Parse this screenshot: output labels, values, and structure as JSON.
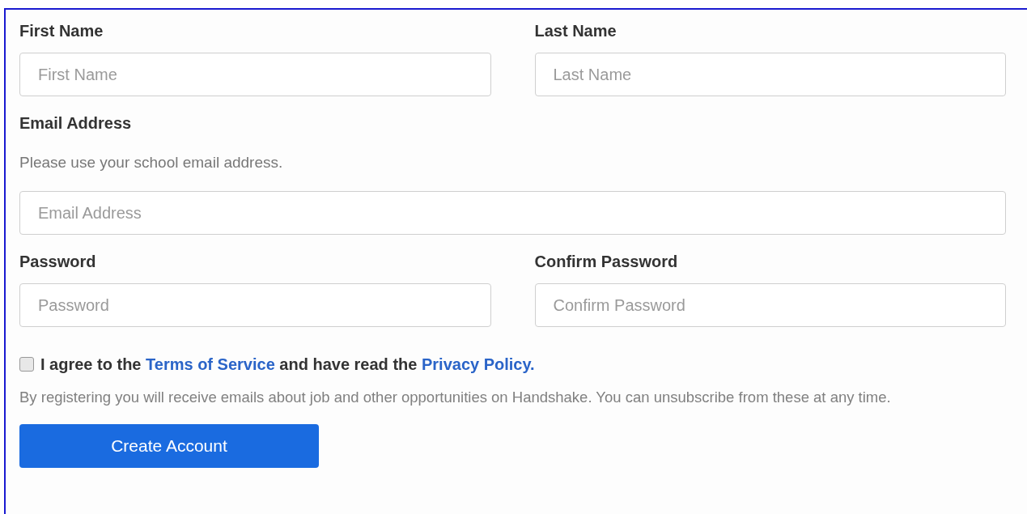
{
  "name_fields": [
    {
      "label": "First Name",
      "placeholder": "First Name"
    },
    {
      "label": "Last Name",
      "placeholder": "Last Name"
    }
  ],
  "email": {
    "label": "Email Address",
    "hint": "Please use your school email address.",
    "placeholder": "Email Address"
  },
  "password_fields": [
    {
      "label": "Password",
      "placeholder": "Password"
    },
    {
      "label": "Confirm Password",
      "placeholder": "Confirm Password"
    }
  ],
  "agreement": {
    "checked": false,
    "text_before": "I agree to the",
    "terms_link": "Terms of Service",
    "text_middle": "and have read the",
    "privacy_link": "Privacy Policy."
  },
  "notice": "By registering you will receive emails about job and other opportunities on Handshake. You can unsubscribe from these at any time.",
  "submit_button": "Create Account"
}
